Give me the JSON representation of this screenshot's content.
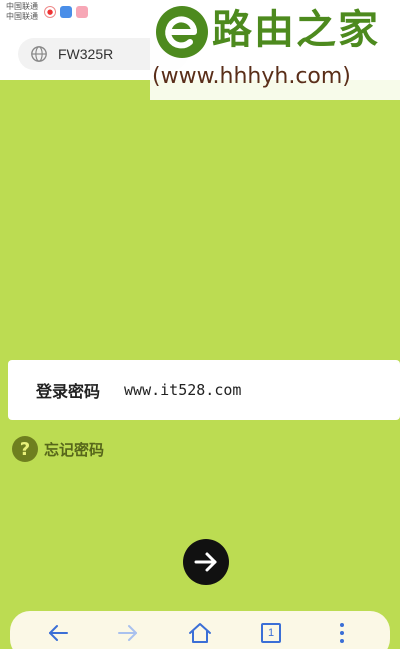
{
  "status_bar": {
    "carrier_line1": "中国联通",
    "carrier_line2": "中国联通"
  },
  "browser": {
    "url": "FW325R",
    "icons": [
      "globe-icon"
    ]
  },
  "watermark": {
    "title": "路由之家",
    "url": "(www.hhhyh.com)"
  },
  "login": {
    "password_label": "登录密码",
    "password_value": "www.it528.com",
    "forgot_label": "忘记密码",
    "forgot_icon": "?"
  },
  "toolbar": {
    "tab_count": "1",
    "icons": [
      "back-icon",
      "forward-icon",
      "home-icon",
      "tabs-icon",
      "menu-icon"
    ]
  },
  "colors": {
    "background": "#bcdc52",
    "accent_blue": "#3b6fd6",
    "watermark_green": "#4d8a1e"
  }
}
